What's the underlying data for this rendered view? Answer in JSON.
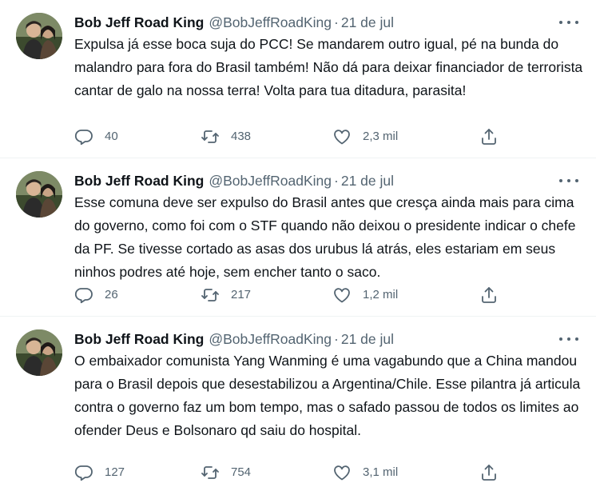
{
  "tweets": [
    {
      "name": "Bob Jeff Road King",
      "handle": "@BobJeffRoadKing",
      "separator": "·",
      "date": "21 de jul",
      "text": "Expulsa já esse boca suja do PCC! Se mandarem outro igual, pé na bunda do malandro para fora do Brasil também! Não dá para deixar financiador de terrorista cantar de galo na nossa terra! Volta para tua ditadura, parasita!",
      "replies": "40",
      "retweets": "438",
      "likes": "2,3 mil"
    },
    {
      "name": "Bob Jeff Road King",
      "handle": "@BobJeffRoadKing",
      "separator": "·",
      "date": "21 de jul",
      "text": "Esse comuna deve ser expulso do Brasil antes que cresça ainda mais para cima do governo, como foi com o STF quando não deixou o presidente indicar o chefe da PF. Se tivesse cortado as asas dos urubus lá atrás, eles estariam em seus ninhos podres até hoje, sem encher tanto o saco.",
      "replies": "26",
      "retweets": "217",
      "likes": "1,2 mil"
    },
    {
      "name": "Bob Jeff Road King",
      "handle": "@BobJeffRoadKing",
      "separator": "·",
      "date": "21 de jul",
      "text": "O embaixador comunista Yang Wanming é uma vagabundo que a China mandou para o Brasil depois que desestabilizou a Argentina/Chile. Esse pilantra já articula contra o governo faz um bom tempo, mas o safado passou de todos os limites ao ofender Deus e Bolsonaro qd saiu do hospital.",
      "replies": "127",
      "retweets": "754",
      "likes": "3,1 mil"
    }
  ],
  "icons": {
    "reply": "reply-icon",
    "retweet": "retweet-icon",
    "like": "heart-icon",
    "share": "share-icon",
    "more": "more-icon"
  },
  "colors": {
    "text": "#0f1419",
    "secondary": "#536471",
    "divider": "#eff3f4"
  }
}
